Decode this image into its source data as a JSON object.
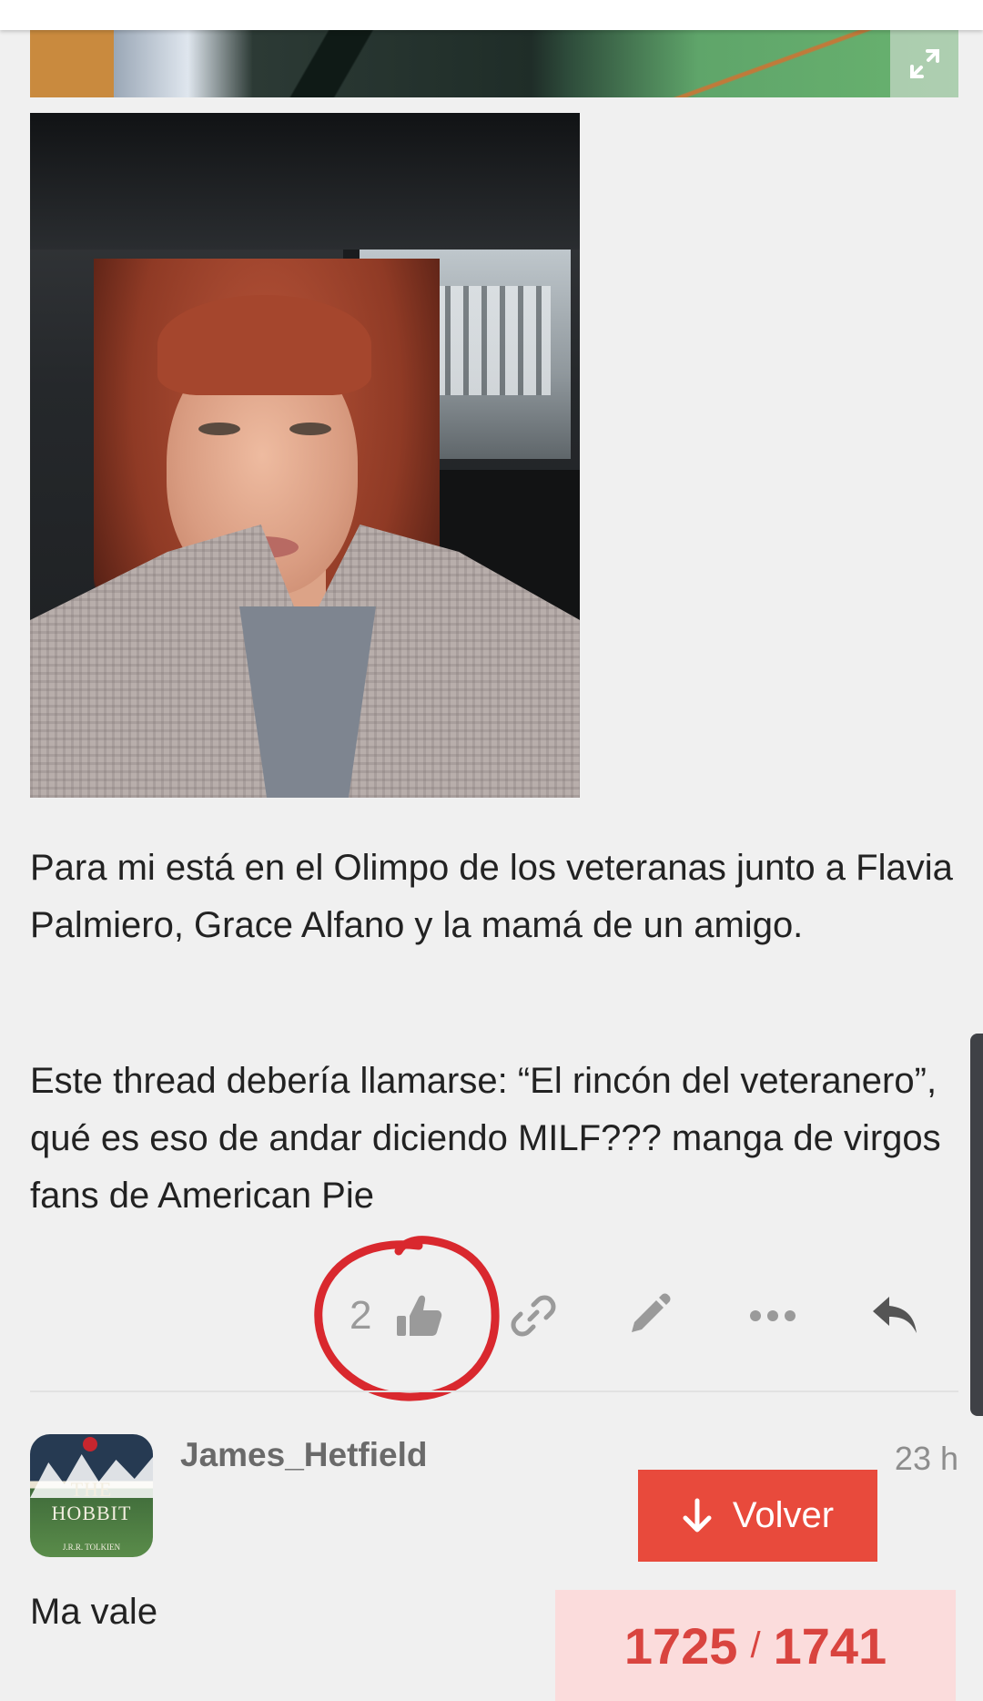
{
  "post": {
    "paragraphs": [
      "Para mi está en el Olimpo de los veteranas junto a Flavia Palmiero, Grace Alfano y la mamá de un amigo.",
      "Este thread debería llamarse: “El rincón del veteranero”, qué es eso de andar diciendo MILF??? manga de virgos fans de American Pie"
    ],
    "like_count": "2",
    "icons": {
      "expand": "expand-icon",
      "like": "thumbs-up-icon",
      "link": "link-icon",
      "edit": "pencil-icon",
      "more": "ellipsis-icon",
      "reply": "reply-icon"
    }
  },
  "next_post": {
    "username": "James_Hetfield",
    "time": "23 h",
    "text": "Ma vale",
    "avatar": {
      "title": "THE HOBBIT",
      "author": "J.R.R. TOLKIEN"
    }
  },
  "navigation": {
    "volver_label": "Volver",
    "current": "1725",
    "total": "1741",
    "separator": "/"
  },
  "colors": {
    "accent": "#e84a3c",
    "progress_bg": "#fbdcdc",
    "progress_text": "#d9443f",
    "annotation_circle": "#d9282e"
  }
}
